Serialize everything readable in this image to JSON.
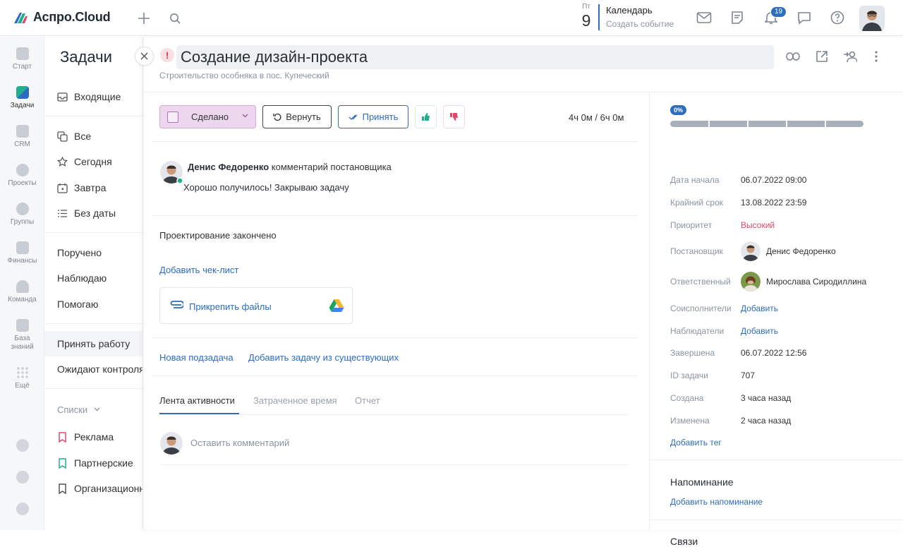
{
  "topbar": {
    "logo_text": "Аспро.Cloud",
    "date_dow": "Пт",
    "date_day": "9",
    "calendar_title": "Календарь",
    "calendar_action": "Создать событие",
    "notifications_count": "19",
    "icons": [
      "plus-icon",
      "search-icon",
      "mail-icon",
      "news-icon",
      "bell-icon",
      "chat-icon",
      "help-icon"
    ]
  },
  "rail": {
    "items": [
      {
        "label": "Старт"
      },
      {
        "label": "Задачи"
      },
      {
        "label": "CRM"
      },
      {
        "label": "Проекты"
      },
      {
        "label": "Группы"
      },
      {
        "label": "Финансы"
      },
      {
        "label": "Команда"
      },
      {
        "label": "База знаний"
      },
      {
        "label": "Ещё"
      }
    ]
  },
  "nav": {
    "title": "Задачи",
    "inbox": "Входящие",
    "all": "Все",
    "today": "Сегодня",
    "tomorrow": "Завтра",
    "no_date": "Без даты",
    "assigned": "Поручено",
    "watching": "Наблюдаю",
    "helping": "Помогаю",
    "accept_work": "Принять работу",
    "awaiting_control": "Ожидают контроля",
    "lists_label": "Списки",
    "list_1": "Реклама",
    "list_2": "Партнерские",
    "list_3": "Организационные"
  },
  "task": {
    "title": "Создание дизайн-проекта",
    "project": "Строительство особняка в пос. Купеческий",
    "done_label": "Сделано",
    "back_label": "Вернуть",
    "accept_label": "Принять",
    "time_spent": "4ч 0м / 6ч 0м",
    "comment_author": "Денис Федоренко",
    "comment_role": "комментарий постановщика",
    "comment_text": "Хорошо получилось! Закрываю задачу",
    "description": "Проектирование закончено",
    "add_checklist": "Добавить чек-лист",
    "attach_files": "Прикрепить файлы",
    "new_subtask": "Новая подзадача",
    "add_existing": "Добавить задачу из существующих",
    "tabs": [
      "Лента активности",
      "Затраченное время",
      "Отчет"
    ],
    "comment_placeholder": "Оставить комментарий"
  },
  "details": {
    "progress_label": "0%",
    "progress_value": 0,
    "start_label": "Дата начала",
    "start_value": "06.07.2022 09:00",
    "deadline_label": "Крайний срок",
    "deadline_value": "13.08.2022 23:59",
    "priority_label": "Приоритет",
    "priority_value": "Высокий",
    "creator_label": "Постановщик",
    "creator_value": "Денис Федоренко",
    "responsible_label": "Ответственный",
    "responsible_value": "Мирослава Сиродиллина",
    "coexec_label": "Соисполнители",
    "coexec_value": "Добавить",
    "watchers_label": "Наблюдатели",
    "watchers_value": "Добавить",
    "completed_label": "Завершена",
    "completed_value": "06.07.2022 12:56",
    "id_label": "ID задачи",
    "id_value": "707",
    "created_label": "Создана",
    "created_value": "3 часа назад",
    "modified_label": "Изменена",
    "modified_value": "2 часа назад",
    "add_tag": "Добавить тег",
    "reminder_title": "Напоминание",
    "add_reminder": "Добавить напоминание",
    "links_title": "Связи"
  },
  "colors": {
    "accent": "#2d6cc0",
    "done_bg": "#ecd7ef",
    "priority_high": "#e0496a",
    "alert": "#d9364e"
  }
}
